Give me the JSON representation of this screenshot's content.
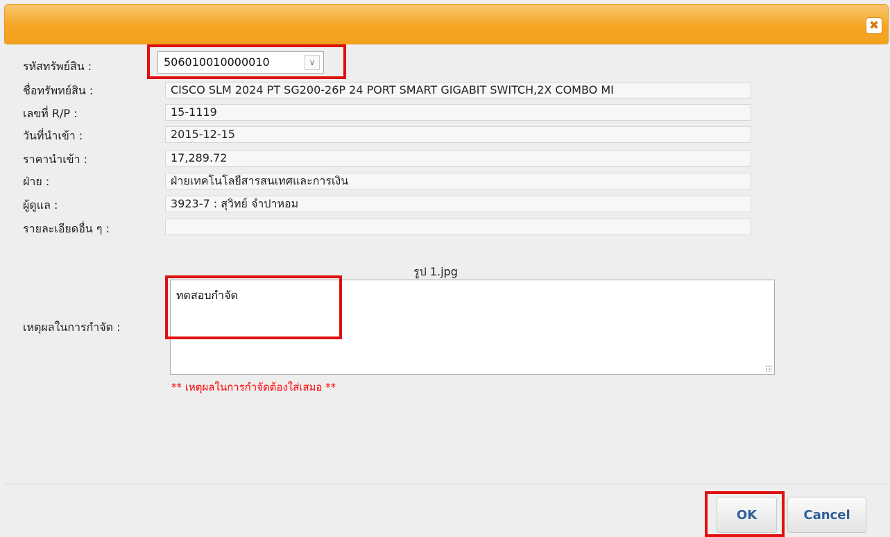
{
  "dialog": {
    "close_icon": "close-icon",
    "close_glyph": "✖"
  },
  "fields": {
    "asset_code_label": "รหัสทรัพย์สิน :",
    "asset_code_value": "506010010000010",
    "asset_name_label": "ชื่อทรัพทย์สิน :",
    "asset_name_value": "CISCO SLM 2024 PT SG200-26P 24 PORT SMART GIGABIT SWITCH,2X COMBO MI",
    "rp_label": "เลขที่ R/P :",
    "rp_value": "15-1119",
    "import_date_label": "วันที่นำเข้า :",
    "import_date_value": "2015-12-15",
    "import_price_label": "ราคานำเข้า :",
    "import_price_value": "17,289.72",
    "department_label": "ฝ่าย :",
    "department_value": "ฝ่ายเทคโนโลยีสารสนเทศและการเงิน",
    "caretaker_label": "ผู้ดูแล :",
    "caretaker_value": "3923-7 : สุวิทย์  จำปาหอม",
    "other_details_label": "รายละเอียดอื่น ๆ :",
    "other_details_value": ""
  },
  "image_caption": "รูป 1.jpg",
  "disposal": {
    "reason_label": "เหตุผลในการกำจัด :",
    "reason_value": "ทดสอบกำจัด",
    "warning": "** เหตุผลในการกำจัดต้องใส่เสมอ **"
  },
  "footer": {
    "ok_label": "OK",
    "cancel_label": "Cancel"
  },
  "colors": {
    "titlebar": "#f5a623",
    "highlight": "#e01010",
    "warning_text": "#ff0000",
    "button_text": "#2d5f9a"
  }
}
